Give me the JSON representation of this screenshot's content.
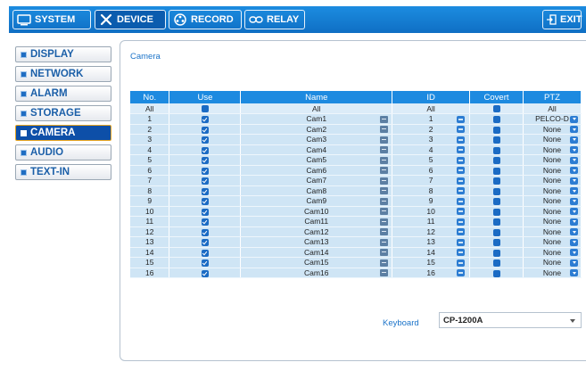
{
  "top_tabs": {
    "system": "SYSTEM",
    "device": "DEVICE",
    "record": "RECORD",
    "relay": "RELAY",
    "exit": "EXIT"
  },
  "sidebar": {
    "items": [
      {
        "label": "DISPLAY"
      },
      {
        "label": "NETWORK"
      },
      {
        "label": "ALARM"
      },
      {
        "label": "STORAGE"
      },
      {
        "label": "CAMERA"
      },
      {
        "label": "AUDIO"
      },
      {
        "label": "TEXT-IN"
      }
    ],
    "active": "CAMERA"
  },
  "panel": {
    "title": "Camera"
  },
  "table": {
    "headers": {
      "no": "No.",
      "use": "Use",
      "name": "Name",
      "id": "ID",
      "covert": "Covert",
      "ptz": "PTZ"
    },
    "all_row": {
      "no": "All",
      "name": "All",
      "id": "All",
      "ptz": "All"
    },
    "rows": [
      {
        "no": "1",
        "use": true,
        "name": "Cam1",
        "id": "1",
        "covert": false,
        "ptz": "PELCO-D"
      },
      {
        "no": "2",
        "use": true,
        "name": "Cam2",
        "id": "2",
        "covert": false,
        "ptz": "None"
      },
      {
        "no": "3",
        "use": true,
        "name": "Cam3",
        "id": "3",
        "covert": false,
        "ptz": "None"
      },
      {
        "no": "4",
        "use": true,
        "name": "Cam4",
        "id": "4",
        "covert": false,
        "ptz": "None"
      },
      {
        "no": "5",
        "use": true,
        "name": "Cam5",
        "id": "5",
        "covert": false,
        "ptz": "None"
      },
      {
        "no": "6",
        "use": true,
        "name": "Cam6",
        "id": "6",
        "covert": false,
        "ptz": "None"
      },
      {
        "no": "7",
        "use": true,
        "name": "Cam7",
        "id": "7",
        "covert": false,
        "ptz": "None"
      },
      {
        "no": "8",
        "use": true,
        "name": "Cam8",
        "id": "8",
        "covert": false,
        "ptz": "None"
      },
      {
        "no": "9",
        "use": true,
        "name": "Cam9",
        "id": "9",
        "covert": false,
        "ptz": "None"
      },
      {
        "no": "10",
        "use": true,
        "name": "Cam10",
        "id": "10",
        "covert": false,
        "ptz": "None"
      },
      {
        "no": "11",
        "use": true,
        "name": "Cam11",
        "id": "11",
        "covert": false,
        "ptz": "None"
      },
      {
        "no": "12",
        "use": true,
        "name": "Cam12",
        "id": "12",
        "covert": false,
        "ptz": "None"
      },
      {
        "no": "13",
        "use": true,
        "name": "Cam13",
        "id": "13",
        "covert": false,
        "ptz": "None"
      },
      {
        "no": "14",
        "use": true,
        "name": "Cam14",
        "id": "14",
        "covert": false,
        "ptz": "None"
      },
      {
        "no": "15",
        "use": true,
        "name": "Cam15",
        "id": "15",
        "covert": false,
        "ptz": "None"
      },
      {
        "no": "16",
        "use": true,
        "name": "Cam16",
        "id": "16",
        "covert": false,
        "ptz": "None"
      }
    ]
  },
  "keyboard": {
    "label": "Keyboard",
    "value": "CP-1200A"
  },
  "colors": {
    "header_blue": "#1d8ae0",
    "row_bg": "#cfe5f5",
    "active_sidebar": "#0d4fa8",
    "active_border": "#e7a420"
  }
}
